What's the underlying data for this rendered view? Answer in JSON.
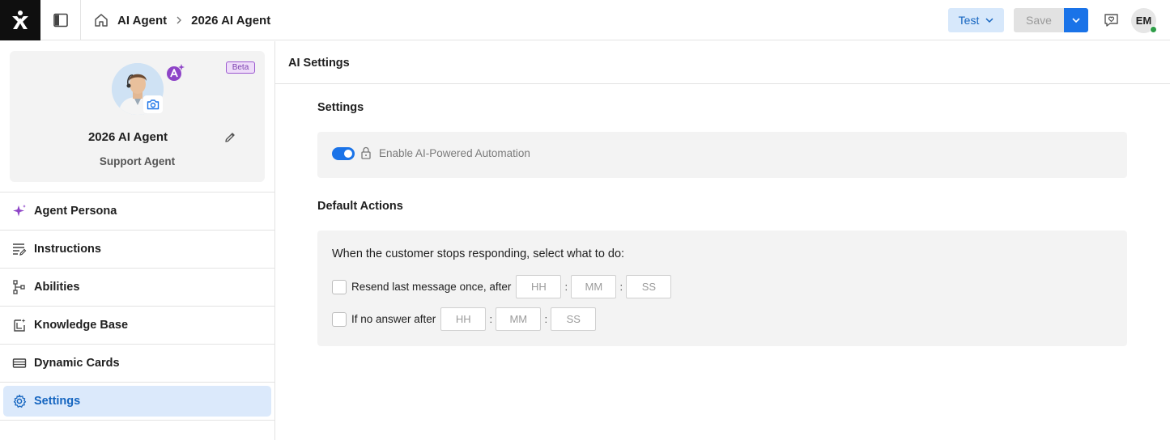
{
  "header": {
    "breadcrumb": [
      "AI Agent",
      "2026 AI Agent"
    ],
    "test_label": "Test",
    "save_label": "Save",
    "user_initials": "EM",
    "colors": {
      "accent": "#1a73e8",
      "test_bg": "#d7e8fb",
      "online": "#2e9d48"
    }
  },
  "agent": {
    "name": "2026 AI Agent",
    "role": "Support Agent",
    "beta_label": "Beta"
  },
  "nav": {
    "items": [
      {
        "label": "Agent Persona",
        "icon": "sparkle-icon"
      },
      {
        "label": "Instructions",
        "icon": "list-edit-icon"
      },
      {
        "label": "Abilities",
        "icon": "flow-icon"
      },
      {
        "label": "Knowledge Base",
        "icon": "book-icon"
      },
      {
        "label": "Dynamic Cards",
        "icon": "cards-icon"
      },
      {
        "label": "Settings",
        "icon": "gear-icon",
        "active": true
      }
    ]
  },
  "main": {
    "title": "AI Settings",
    "settings": {
      "heading": "Settings",
      "toggle_label": "Enable AI-Powered Automation",
      "toggle_on": true
    },
    "default_actions": {
      "heading": "Default Actions",
      "prompt": "When the customer stops responding, select what to do:",
      "rows": [
        {
          "label": "Resend last message once, after",
          "checked": false,
          "placeholders": {
            "hh": "HH",
            "mm": "MM",
            "ss": "SS"
          }
        },
        {
          "label": "If no answer after",
          "checked": false,
          "placeholders": {
            "hh": "HH",
            "mm": "MM",
            "ss": "SS"
          }
        }
      ]
    }
  }
}
